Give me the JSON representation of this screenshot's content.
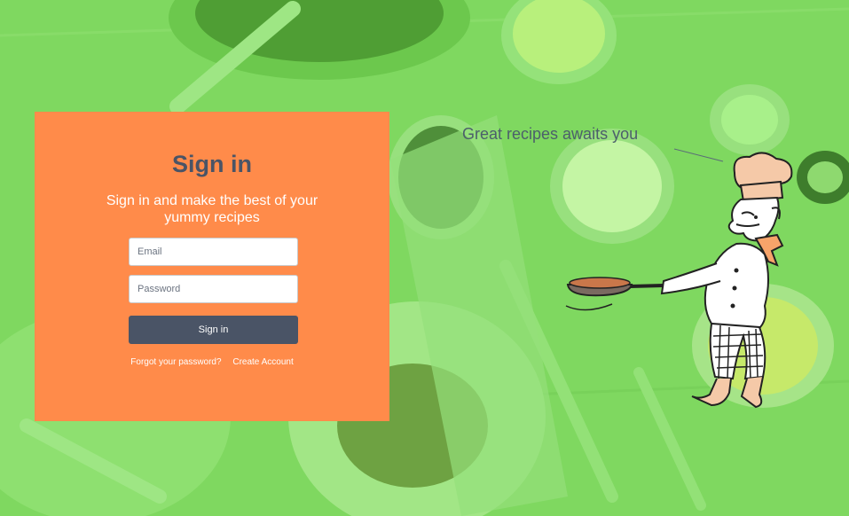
{
  "signin": {
    "title": "Sign in",
    "subtitle": "Sign in and make the best of your yummy recipes",
    "email_placeholder": "Email",
    "password_placeholder": "Password",
    "submit_label": "Sign in",
    "forgot_link": "Forgot your password?",
    "create_link": "Create Account"
  },
  "hero": {
    "tagline": "Great recipes awaits you"
  },
  "colors": {
    "overlay": "#7fd860",
    "card": "#ff8b4a",
    "primary": "#4a5466"
  },
  "icons": {
    "illustration": "chef-cooking-illustration",
    "background": "food-background-image"
  }
}
